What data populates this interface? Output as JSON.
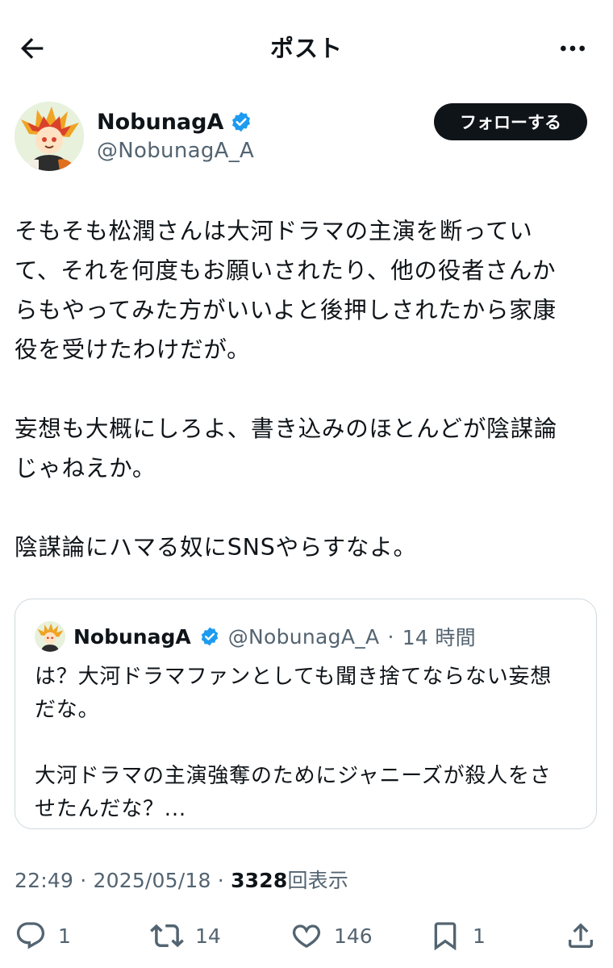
{
  "header": {
    "title": "ポスト",
    "back_icon": "arrow-left-icon",
    "more_icon": "more-horizontal-icon"
  },
  "author": {
    "name": "NobunagA",
    "handle": "@NobunagA_A",
    "verified_icon": "verified-badge-icon",
    "follow_label": "フォローする"
  },
  "post": {
    "paragraph1": [
      "そもそも松潤さんは大河ドラマの主演を断ってい",
      "て、それを何度もお願いされたり、他の役者さんか",
      "らもやってみた方がいいよと後押しされたから家康",
      "役を受けたわけだが。"
    ],
    "paragraph2": [
      "妄想も大概にしろよ、書き込みのほとんどが陰謀論",
      "じゃねえか。"
    ],
    "paragraph3": [
      "陰謀論にハマる奴にSNSやらすなよ。"
    ]
  },
  "quote": {
    "name": "NobunagA",
    "handle": "@NobunagA_A",
    "separator": "·",
    "time": "14 時間",
    "paragraph1": [
      "は？大河ドラマファンとしても聞き捨てならない妄想",
      "だな。"
    ],
    "paragraph2": [
      "大河ドラマの主演強奪のためにジャニーズが殺人をさ",
      "せたんだな？..."
    ]
  },
  "meta": {
    "time": "22:49",
    "separator": "·",
    "date": "2025/05/18",
    "views_count": "3328",
    "views_label": "回表示"
  },
  "actions": {
    "reply_count": "1",
    "repost_count": "14",
    "like_count": "146",
    "bookmark_count": "1"
  },
  "colors": {
    "text": "#0f1419",
    "secondary": "#536471",
    "verified": "#1d9bf0",
    "border": "#cfd9de",
    "follow_bg": "#0f1419"
  }
}
